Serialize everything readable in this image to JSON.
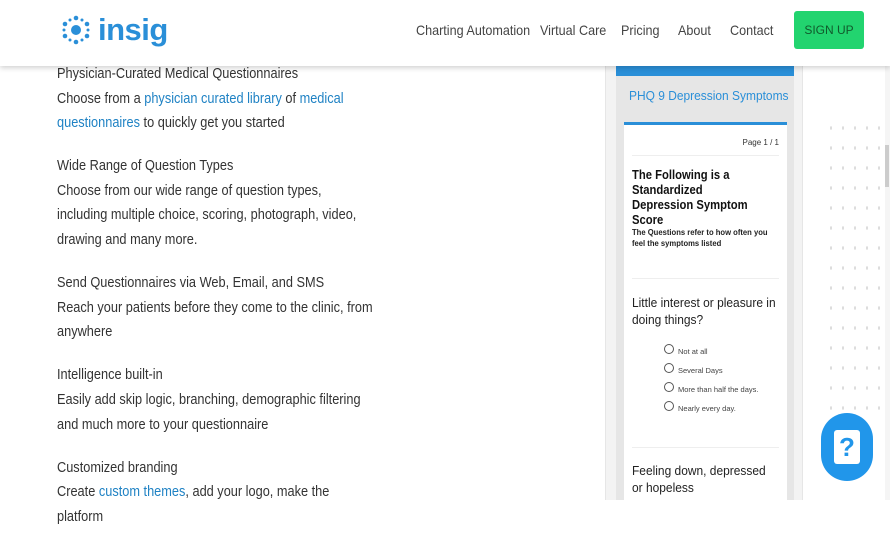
{
  "header": {
    "logo": "insig",
    "nav": [
      "Charting Automation",
      "Virtual Care",
      "Pricing",
      "About",
      "Contact"
    ],
    "signup": "SIGN UP"
  },
  "features": [
    {
      "title": "Physician-Curated Medical Questionnaires",
      "desc": [
        {
          "t": "Choose from a "
        },
        {
          "t": "physician curated library",
          "link": true
        },
        {
          "t": " of "
        },
        {
          "t": "medical questionnaires",
          "link": true
        },
        {
          "t": " to quickly get you started"
        }
      ]
    },
    {
      "title": "Wide Range of Question Types",
      "desc": [
        {
          "t": "Choose from our wide range of question types, including multiple choice, scoring, photograph, video, drawing and many more."
        }
      ]
    },
    {
      "title": "Send Questionnaires via Web, Email, and SMS",
      "desc": [
        {
          "t": "Reach your patients before they come to the clinic, from anywhere"
        }
      ]
    },
    {
      "title": "Intelligence built-in",
      "desc": [
        {
          "t": "Easily add skip logic, branching, demographic filtering and much more to your questionnaire"
        }
      ]
    },
    {
      "title": "Customized branding",
      "desc": [
        {
          "t": "Create "
        },
        {
          "t": "custom themes",
          "link": true
        },
        {
          "t": ", add your logo, make the platform"
        }
      ]
    }
  ],
  "phone": {
    "title": "PHQ 9 Depression Symptoms",
    "page": "Page 1 / 1",
    "heading": "The Following is a Standardized Depression Symptom Score",
    "sub": "The Questions refer to how often you feel the symptoms listed",
    "q1": "Little interest or pleasure in doing things?",
    "options": [
      "Not at all",
      "Several Days",
      "More than half the days.",
      "Nearly every day."
    ],
    "q2": "Feeling down, depressed or hopeless"
  },
  "help": "?"
}
